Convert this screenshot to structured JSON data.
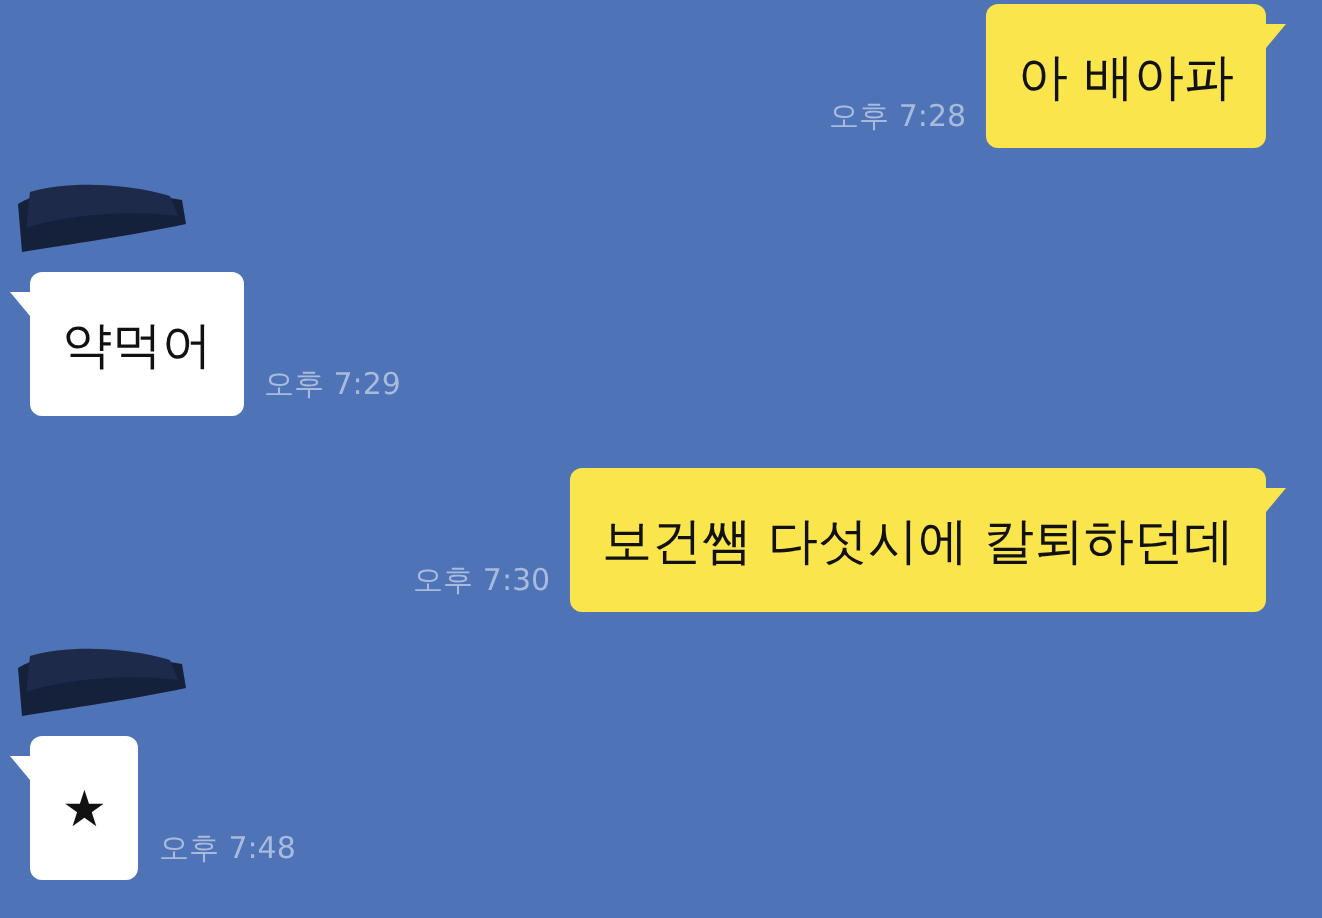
{
  "messages": [
    {
      "kind": "sent",
      "text": "아 배아파",
      "time": "오후 7:28"
    },
    {
      "kind": "received",
      "text": "약먹어",
      "time": "오후 7:29"
    },
    {
      "kind": "sent",
      "text": "보건쌤 다섯시에 칼퇴하던데",
      "time": "오후 7:30"
    },
    {
      "kind": "received",
      "text": "★",
      "time": "오후 7:48"
    }
  ]
}
